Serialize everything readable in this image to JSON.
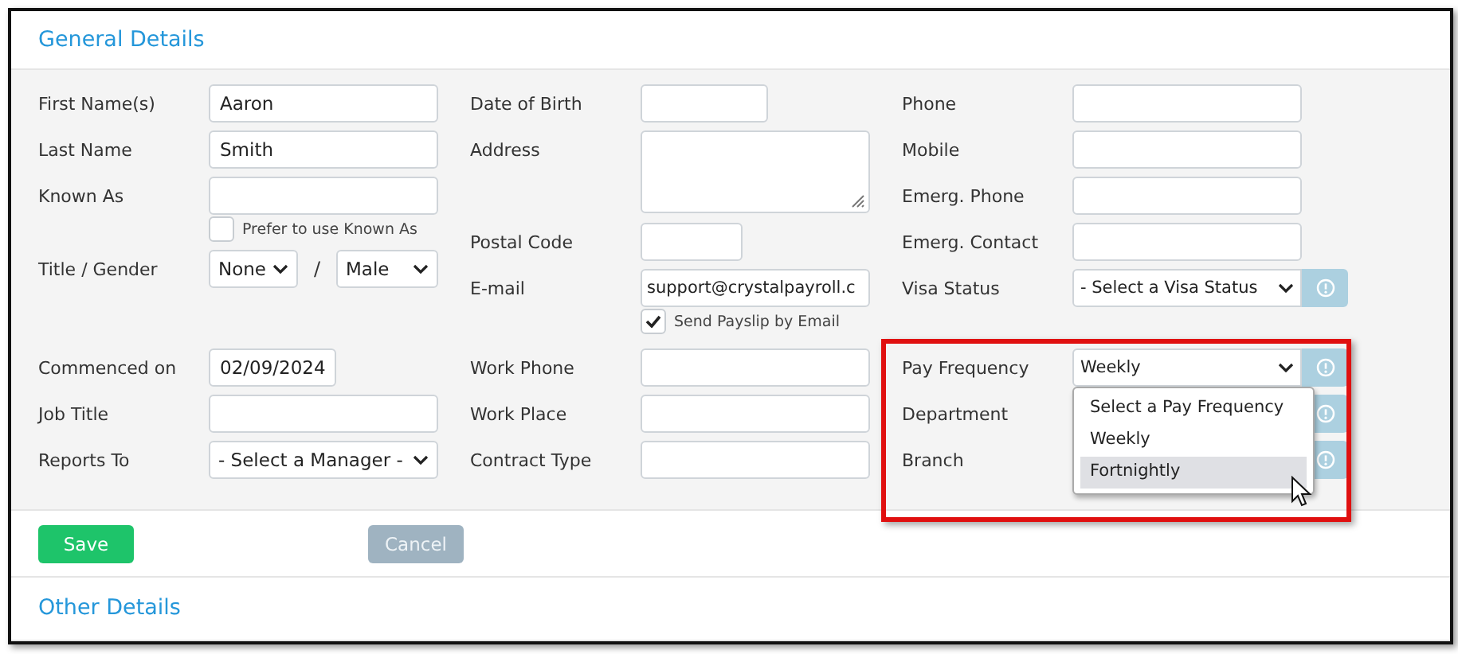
{
  "header": {
    "title": "General Details"
  },
  "form": {
    "upper": [
      {
        "fields": [
          {
            "kind": "text",
            "label": "First Name(s)",
            "value": "Aaron"
          },
          {
            "kind": "text",
            "label": "Last Name",
            "value": "Smith"
          },
          {
            "kind": "text",
            "label": "Known As"
          },
          {
            "kind": "checkbox",
            "label": "Prefer to use Known As",
            "checked": false
          },
          {
            "kind": "select-pair",
            "label": "Title / Gender",
            "separator": "/",
            "selects": [
              {
                "value": "None"
              },
              {
                "value": "Male"
              }
            ]
          }
        ]
      },
      {
        "fields": [
          {
            "kind": "date",
            "label": "Date of Birth"
          },
          {
            "kind": "textarea",
            "label": "Address"
          },
          {
            "kind": "short",
            "label": "Postal Code"
          },
          {
            "kind": "text",
            "label": "E-mail",
            "value": "support@crystalpayroll.c"
          },
          {
            "kind": "checkbox",
            "label": "Send Payslip by Email",
            "checked": true
          }
        ]
      },
      {
        "fields": [
          {
            "kind": "text",
            "label": "Phone"
          },
          {
            "kind": "text",
            "label": "Mobile"
          },
          {
            "kind": "text",
            "label": "Emerg. Phone"
          },
          {
            "kind": "text",
            "label": "Emerg. Contact"
          },
          {
            "kind": "select",
            "label": "Visa Status",
            "value": "- Select a Visa Status",
            "info": true
          }
        ]
      }
    ],
    "lower": [
      {
        "fields": [
          {
            "kind": "date",
            "label": "Commenced on",
            "value": "02/09/2024"
          },
          {
            "kind": "text",
            "label": "Job Title"
          },
          {
            "kind": "select",
            "label": "Reports To",
            "value": "- Select a Manager -"
          }
        ]
      },
      {
        "fields": [
          {
            "kind": "text",
            "label": "Work Phone"
          },
          {
            "kind": "text",
            "label": "Work Place"
          },
          {
            "kind": "text",
            "label": "Contract Type"
          }
        ]
      },
      {
        "highlighted": true,
        "fields": [
          {
            "kind": "select",
            "label": "Pay Frequency",
            "value": "Weekly",
            "info": true,
            "open": true,
            "options": [
              {
                "label": "Select a Pay Frequency",
                "highlighted": false
              },
              {
                "label": "Weekly",
                "highlighted": false
              },
              {
                "label": "Fortnightly",
                "highlighted": true
              }
            ]
          },
          {
            "kind": "covered",
            "label": "Department",
            "info": true
          },
          {
            "kind": "covered",
            "label": "Branch",
            "info": true
          }
        ]
      }
    ]
  },
  "buttons": [
    {
      "label": "Save",
      "kind": "primary"
    },
    {
      "label": "Cancel",
      "kind": "secondary"
    }
  ],
  "other_section": {
    "title": "Other Details"
  }
}
